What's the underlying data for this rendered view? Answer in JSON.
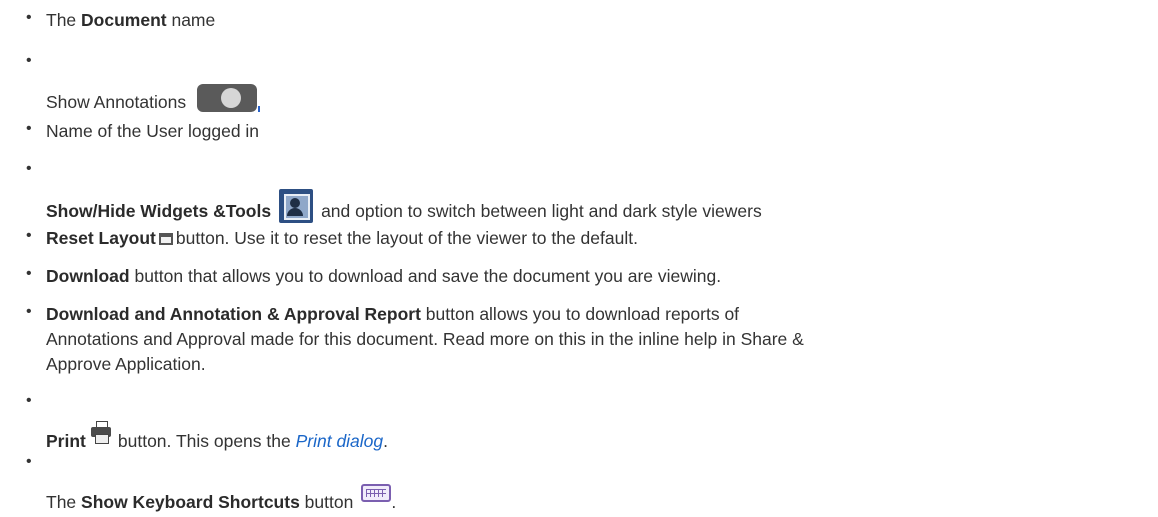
{
  "items": [
    {
      "pre": "The ",
      "bold": "Document",
      "post": " name"
    },
    {
      "text": "Show Annotations"
    },
    {
      "text": "Name of the User logged in"
    },
    {
      "bold": "Show/Hide Widgets &Tools",
      "post": "and option to switch between light and dark style viewers"
    },
    {
      "bold": "Reset Layout",
      "post": "button. Use it to reset the layout of the viewer to the default."
    },
    {
      "bold": "Download",
      "post": " button that allows you to download and save the document you are viewing."
    },
    {
      "bold": "Download and Annotation & Approval Report",
      "post": " button allows you to download reports of",
      "line2": "Annotations and Approval made for this document. Read more on this in the inline help in Share &",
      "line3": "Approve Application."
    },
    {
      "bold": "Print",
      "post": "button. This opens the ",
      "link": "Print dialog",
      "end": "."
    },
    {
      "pre": "The ",
      "bold": "Show Keyboard Shortcuts",
      "post": " button",
      "end": "."
    }
  ],
  "bullet": "•",
  "colors": {
    "link": "#1a66c8",
    "toggle": "#5a5a5a",
    "widgets_icon": "#2d4f83"
  },
  "icons": [
    "toggle-switch-icon",
    "widgets-tools-icon",
    "reset-layout-icon",
    "printer-icon",
    "keyboard-icon"
  ]
}
